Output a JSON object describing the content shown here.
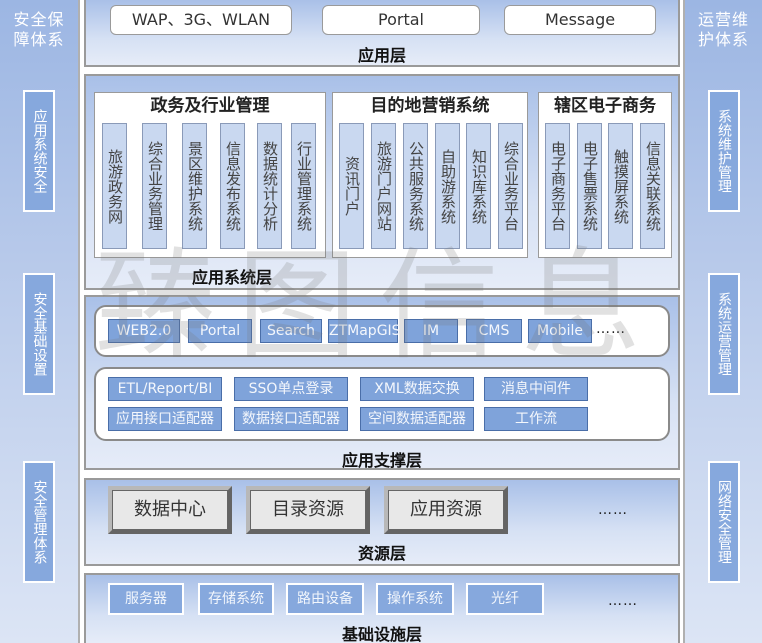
{
  "left_side": {
    "title": "安全保障体系",
    "boxes": [
      "应用系统安全",
      "安全基础设置",
      "安全管理体系"
    ]
  },
  "right_side": {
    "title": "运营维护体系",
    "boxes": [
      "系统维护管理",
      "系统运营管理",
      "网络安全管理"
    ]
  },
  "app_layer": {
    "label": "应用层",
    "channels": [
      "WAP、3G、WLAN",
      "Portal",
      "Message"
    ]
  },
  "system_layer": {
    "label": "应用系统层",
    "groups": [
      {
        "title": "政务及行业管理",
        "items": [
          "旅游政务网",
          "综合业务管理",
          "景区维护系统",
          "信息发布系统",
          "数据统计分析",
          "行业管理系统"
        ]
      },
      {
        "title": "目的地营销系统",
        "items": [
          "资讯门户",
          "旅游门户网站",
          "公共服务系统",
          "自助游系统",
          "知识库系统",
          "综合业务平台"
        ]
      },
      {
        "title": "辖区电子商务",
        "items": [
          "电子商务平台",
          "电子售票系统",
          "触摸屏系统",
          "信息关联系统"
        ]
      }
    ]
  },
  "support_layer": {
    "label": "应用支撑层",
    "row1": [
      "WEB2.0",
      "Portal",
      "Search",
      "ZTMapGIS",
      "IM",
      "CMS",
      "Mobile"
    ],
    "row1_more": "……",
    "row2": [
      "ETL/Report/BI",
      "SSO单点登录",
      "XML数据交换",
      "消息中间件"
    ],
    "row3": [
      "应用接口适配器",
      "数据接口适配器",
      "空间数据适配器",
      "工作流"
    ]
  },
  "resource_layer": {
    "label": "资源层",
    "items": [
      "数据中心",
      "目录资源",
      "应用资源"
    ],
    "more": "……"
  },
  "infra_layer": {
    "label": "基础设施层",
    "items": [
      "服务器",
      "存储系统",
      "路由设备",
      "操作系统",
      "光纤"
    ],
    "more": "……"
  },
  "watermark": "臻图信息"
}
